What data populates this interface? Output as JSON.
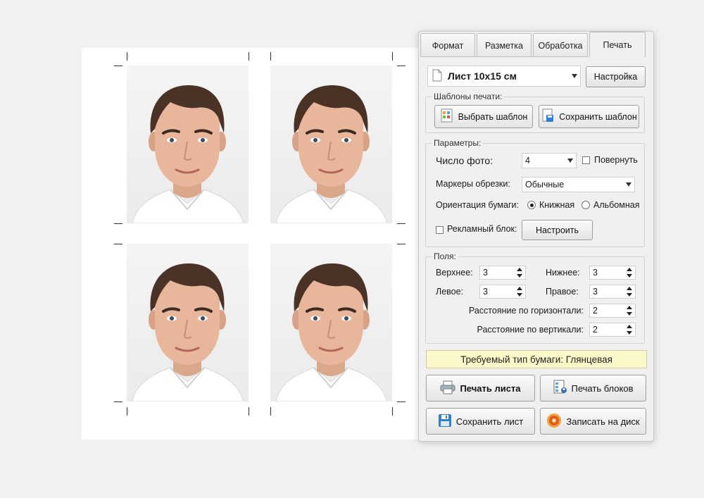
{
  "tabs": [
    {
      "label": "Формат",
      "active": false
    },
    {
      "label": "Разметка",
      "active": false
    },
    {
      "label": "Обработка",
      "active": false
    },
    {
      "label": "Печать",
      "active": true
    }
  ],
  "paper": {
    "value": "Лист 10x15 см",
    "settings_label": "Настройка"
  },
  "templates": {
    "title": "Шаблоны печати:",
    "choose_label": "Выбрать шаблон",
    "save_label": "Сохранить шаблон"
  },
  "params": {
    "title": "Параметры:",
    "photo_count_label": "Число фото:",
    "photo_count_value": "4",
    "rotate_label": "Повернуть",
    "crop_markers_label": "Маркеры обрезки:",
    "crop_markers_value": "Обычные",
    "orientation_label": "Ориентация бумаги:",
    "portrait_label": "Книжная",
    "landscape_label": "Альбомная",
    "orientation_selected": "portrait",
    "ad_block_label": "Рекламный блок:",
    "configure_label": "Настроить"
  },
  "margins": {
    "title": "Поля:",
    "top_label": "Верхнее:",
    "top_value": "3",
    "bottom_label": "Нижнее:",
    "bottom_value": "3",
    "left_label": "Левое:",
    "left_value": "3",
    "right_label": "Правое:",
    "right_value": "3",
    "hgap_label": "Расстояние по горизонтали:",
    "hgap_value": "2",
    "vgap_label": "Расстояние по вертикали:",
    "vgap_value": "2"
  },
  "notice": "Требуемый тип бумаги: Глянцевая",
  "actions": {
    "print_sheet": "Печать листа",
    "print_blocks": "Печать блоков",
    "save_sheet": "Сохранить лист",
    "burn_disc": "Записать на диск"
  },
  "colors": {
    "notice_bg": "#fbf9c9",
    "panel_bg": "#f0f0f0"
  }
}
